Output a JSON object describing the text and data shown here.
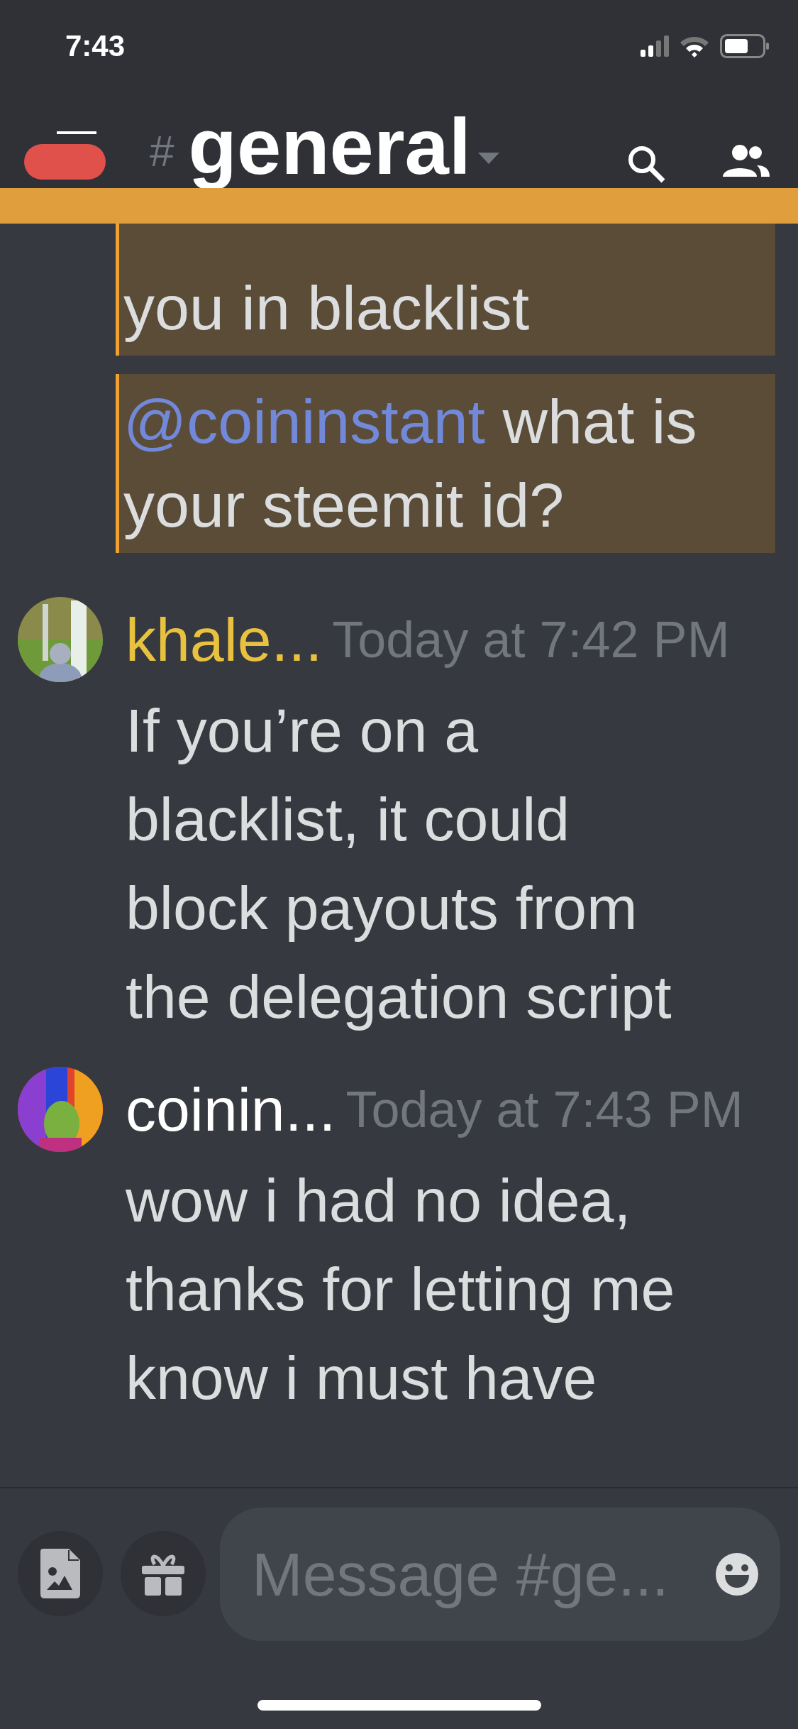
{
  "status_bar": {
    "time": "7:43"
  },
  "header": {
    "unread": true,
    "hash": "#",
    "title": "general"
  },
  "messages": [
    {
      "kind": "highlight",
      "text": "you in blacklist"
    },
    {
      "kind": "highlight",
      "mention": "@coininstant",
      "text": " what is\nyour steemit id?"
    },
    {
      "kind": "post",
      "author": "khale...",
      "color": "#e8c23f",
      "timestamp": "Today at 7:42 PM",
      "text": "If you’re on a\nblacklist, it could\nblock payouts from\nthe delegation script"
    },
    {
      "kind": "post",
      "author": "coinin...",
      "color": "#ffffff",
      "timestamp": "Today at 7:43 PM",
      "text": "wow i had no idea,\nthanks for letting me\nknow i must have"
    }
  ],
  "composer": {
    "placeholder": "Message #ge..."
  }
}
